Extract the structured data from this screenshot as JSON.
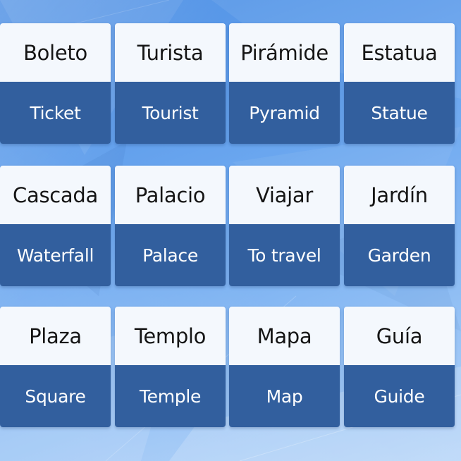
{
  "background_color": "#6aa6ef",
  "card_top_color": "#f4f8fd",
  "card_bottom_color": "#325f9e",
  "cards": [
    {
      "spanish": "Boleto",
      "english": "Ticket"
    },
    {
      "spanish": "Turista",
      "english": "Tourist"
    },
    {
      "spanish": "Pirámide",
      "english": "Pyramid"
    },
    {
      "spanish": "Estatua",
      "english": "Statue"
    },
    {
      "spanish": "Cascada",
      "english": "Waterfall"
    },
    {
      "spanish": "Palacio",
      "english": "Palace"
    },
    {
      "spanish": "Viajar",
      "english": "To travel"
    },
    {
      "spanish": "Jardín",
      "english": "Garden"
    },
    {
      "spanish": "Plaza",
      "english": "Square"
    },
    {
      "spanish": "Templo",
      "english": "Temple"
    },
    {
      "spanish": "Mapa",
      "english": "Map"
    },
    {
      "spanish": "Guía",
      "english": "Guide"
    }
  ]
}
